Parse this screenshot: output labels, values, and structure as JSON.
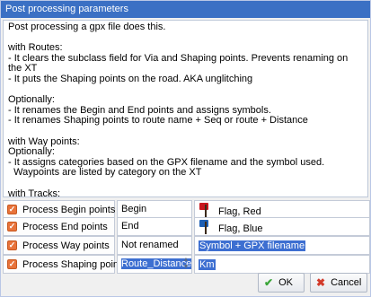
{
  "window": {
    "title": "Post processing parameters"
  },
  "description": {
    "paragraphs": [
      "Post processing a gpx file does this.",
      "with Routes:\n- It clears the subclass field for Via and Shaping points. Prevents renaming on the XT\n- It puts the Shaping points on the road. AKA unglitching",
      "Optionally:\n- It renames the Begin and End points and assigns symbols.\n- It renames Shaping points to route name + Seq or route + Distance",
      "with Way points:\nOptionally:\n- It assigns categories based on the GPX filename and the symbol used.\n  Waypoints are listed by category on the XT",
      "with Tracks:\n- It leaves them untouched. Tripmanager wil create tracks automatically when transferred to the XT."
    ]
  },
  "rows": {
    "begin": {
      "label": "Process Begin points",
      "checked": true,
      "value": "Begin",
      "symbol": "Flag, Red",
      "symbol_icon": "flag-red-icon"
    },
    "end": {
      "label": "Process End points",
      "checked": true,
      "value": "End",
      "symbol": "Flag, Blue",
      "symbol_icon": "flag-blue-icon"
    },
    "way": {
      "label": "Process Way points",
      "checked": true,
      "value": "Not renamed",
      "option": "Symbol + GPX filename"
    },
    "shaping": {
      "label": "Process Shaping points",
      "checked": true,
      "value": "Route_Distance",
      "unit": "Km"
    }
  },
  "buttons": {
    "ok_label": "OK",
    "cancel_label": "Cancel"
  },
  "colors": {
    "titlebar": "#3b70c4",
    "checkbox": "#e8733b",
    "selection": "#3d6fd1",
    "ok_icon": "#3aa53a",
    "cancel_icon": "#d23a2a"
  }
}
